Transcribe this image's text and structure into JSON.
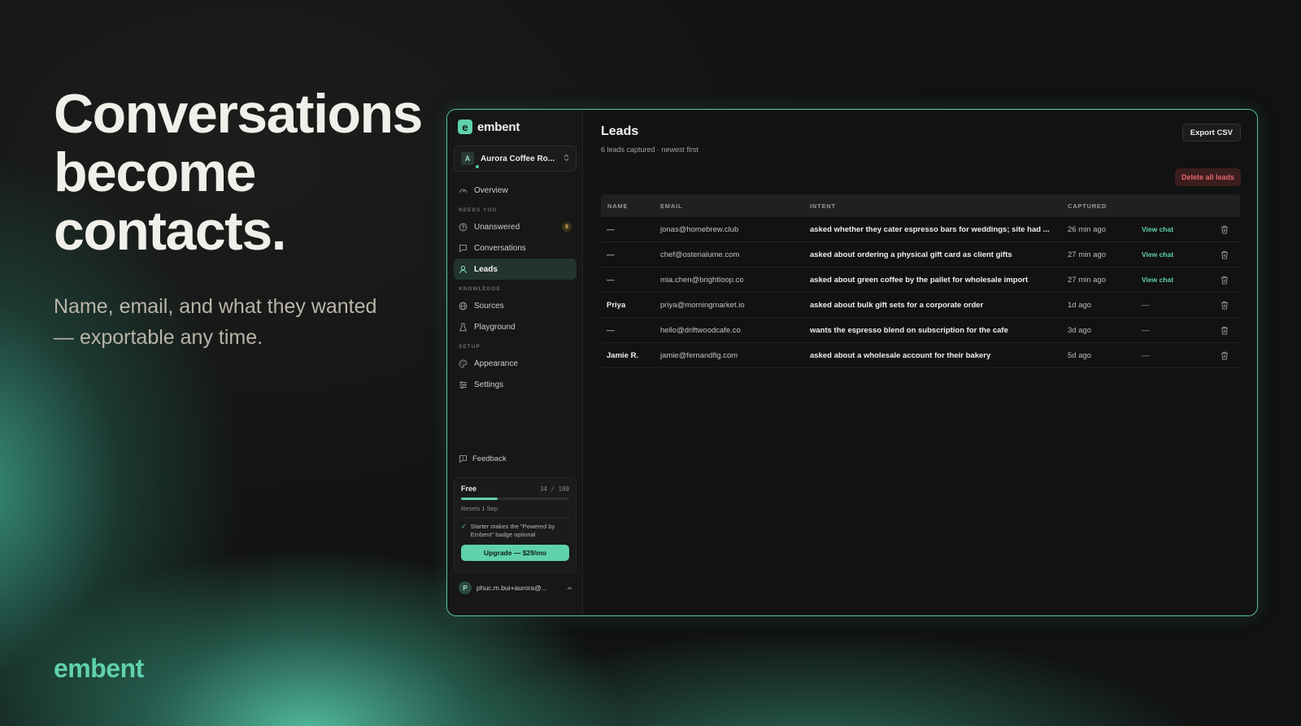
{
  "hero": {
    "title_lines": [
      "Conversations",
      "become",
      "contacts."
    ],
    "subtitle_lines": [
      "Name, email, and what they wanted",
      "— exportable any time."
    ],
    "brand": "embent"
  },
  "app": {
    "logo_letter": "e",
    "logo_text": "embent",
    "workspace": {
      "avatar": "A",
      "name": "Aurora Coffee Ro...",
      "chevron": "⌃⌄"
    },
    "nav": {
      "overview": "Overview",
      "section_needs_you": "NEEDS YOU",
      "unanswered": "Unanswered",
      "unanswered_badge": "9",
      "conversations": "Conversations",
      "leads": "Leads",
      "section_knowledge": "KNOWLEDGE",
      "sources": "Sources",
      "playground": "Playground",
      "section_setup": "SETUP",
      "appearance": "Appearance",
      "settings": "Settings"
    },
    "feedback": "Feedback",
    "plan": {
      "name": "Free",
      "usage": "34 / 100",
      "usage_fraction": 0.34,
      "resets": "Resets 1 Sep",
      "note": "Starter makes the \"Powered by Embent\" badge optional",
      "upgrade_label": "Upgrade — $29/mo"
    },
    "user": {
      "avatar": "P",
      "email": "phuc.m.bui+aurora@..."
    }
  },
  "leads_page": {
    "title": "Leads",
    "subtitle": "6 leads captured · newest first",
    "export_label": "Export CSV",
    "delete_all_label": "Delete all leads",
    "columns": {
      "name": "NAME",
      "email": "EMAIL",
      "intent": "INTENT",
      "captured": "CAPTURED"
    },
    "rows": [
      {
        "name": "—",
        "email": "jonas@homebrew.club",
        "intent": "asked whether they cater espresso bars for weddings; site had ...",
        "captured": "26 min ago",
        "action": "View chat"
      },
      {
        "name": "—",
        "email": "chef@osterialume.com",
        "intent": "asked about ordering a physical gift card as client gifts",
        "captured": "27 min ago",
        "action": "View chat"
      },
      {
        "name": "—",
        "email": "mia.chen@brightloop.co",
        "intent": "asked about green coffee by the pallet for wholesale import",
        "captured": "27 min ago",
        "action": "View chat"
      },
      {
        "name": "Priya",
        "email": "priya@morningmarket.io",
        "intent": "asked about bulk gift sets for a corporate order",
        "captured": "1d ago",
        "action": "—"
      },
      {
        "name": "—",
        "email": "hello@driftwoodcafe.co",
        "intent": "wants the espresso blend on subscription for the cafe",
        "captured": "3d ago",
        "action": "—"
      },
      {
        "name": "Jamie R.",
        "email": "jamie@fernandfig.com",
        "intent": "asked about a wholesale account for their bakery",
        "captured": "5d ago",
        "action": "—"
      }
    ]
  },
  "colors": {
    "accent": "#5fd1ad",
    "danger": "#e46767",
    "badge": "#e1b257"
  }
}
